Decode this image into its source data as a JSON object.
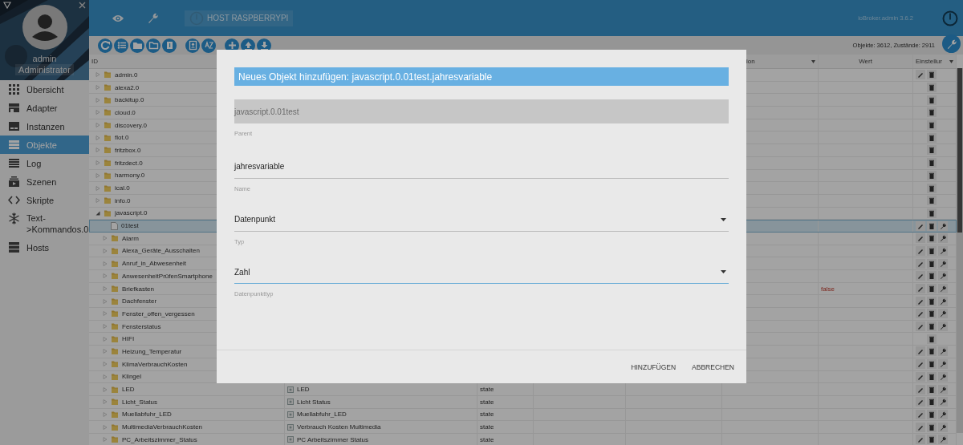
{
  "sidebar": {
    "user": {
      "name": "admin",
      "role": "Administrator"
    },
    "items": [
      {
        "label": "Übersicht",
        "selected": false
      },
      {
        "label": "Adapter",
        "selected": false
      },
      {
        "label": "Instanzen",
        "selected": false
      },
      {
        "label": "Objekte",
        "selected": true
      },
      {
        "label": "Log",
        "selected": false
      },
      {
        "label": "Szenen",
        "selected": false
      },
      {
        "label": "Skripte",
        "selected": false
      },
      {
        "label": "Text->Kommandos.0",
        "selected": false
      },
      {
        "label": "Hosts",
        "selected": false
      }
    ]
  },
  "header": {
    "host": "HOST RASPBERRYPI",
    "version": "ioBroker.admin 3.6.2"
  },
  "toolbar": {
    "stats": "Objekte: 3612, Zustände: 2911"
  },
  "table": {
    "columns": [
      {
        "label": "ID",
        "filter": false
      },
      {
        "label": "ion",
        "filter": true
      },
      {
        "label": "Wert",
        "filter": false
      },
      {
        "label": "Einstellur",
        "filter": true
      }
    ],
    "rows": [
      {
        "id": "admin.0",
        "kind": "folder",
        "expanded": false,
        "selected": false,
        "can_edit": true,
        "has_settings": false
      },
      {
        "id": "alexa2.0",
        "kind": "folder",
        "expanded": false,
        "selected": false,
        "can_edit": false,
        "has_settings": false
      },
      {
        "id": "backitup.0",
        "kind": "folder",
        "expanded": false,
        "selected": false,
        "can_edit": false,
        "has_settings": false
      },
      {
        "id": "cloud.0",
        "kind": "folder",
        "expanded": false,
        "selected": false,
        "can_edit": false,
        "has_settings": false
      },
      {
        "id": "discovery.0",
        "kind": "folder",
        "expanded": false,
        "selected": false,
        "can_edit": false,
        "has_settings": false
      },
      {
        "id": "flot.0",
        "kind": "folder",
        "expanded": false,
        "selected": false,
        "can_edit": false,
        "has_settings": false
      },
      {
        "id": "fritzbox.0",
        "kind": "folder",
        "expanded": false,
        "selected": false,
        "can_edit": false,
        "has_settings": false
      },
      {
        "id": "fritzdect.0",
        "kind": "folder",
        "expanded": false,
        "selected": false,
        "can_edit": false,
        "has_settings": false
      },
      {
        "id": "harmony.0",
        "kind": "folder",
        "expanded": false,
        "selected": false,
        "can_edit": false,
        "has_settings": false
      },
      {
        "id": "ical.0",
        "kind": "folder",
        "expanded": false,
        "selected": false,
        "can_edit": false,
        "has_settings": false
      },
      {
        "id": "info.0",
        "kind": "folder",
        "expanded": false,
        "selected": false,
        "can_edit": false,
        "has_settings": false
      },
      {
        "id": "javascript.0",
        "kind": "folder",
        "expanded": true,
        "selected": false,
        "can_edit": false,
        "has_settings": false,
        "children": [
          {
            "id": "01test",
            "kind": "file",
            "selected": true,
            "can_edit": true,
            "has_settings": true
          },
          {
            "id": "Alarm",
            "kind": "folder",
            "expanded": false,
            "selected": false,
            "can_edit": true,
            "has_settings": true
          },
          {
            "id": "Alexa_Geräte_Ausschalten",
            "kind": "folder",
            "expanded": false,
            "selected": false,
            "can_edit": true,
            "has_settings": true
          },
          {
            "id": "Anruf_in_Abwesenheit",
            "kind": "folder",
            "expanded": false,
            "selected": false,
            "can_edit": true,
            "has_settings": true
          },
          {
            "id": "AnwesenheitPrüfenSmartphone",
            "kind": "folder",
            "expanded": false,
            "selected": false,
            "can_edit": true,
            "has_settings": true
          },
          {
            "id": "Briefkasten",
            "kind": "folder",
            "expanded": false,
            "selected": false,
            "can_edit": true,
            "has_settings": true,
            "value": "false"
          },
          {
            "id": "Dachfenster",
            "kind": "folder",
            "expanded": false,
            "selected": false,
            "can_edit": true,
            "has_settings": true
          },
          {
            "id": "Fenster_offen_vergessen",
            "kind": "folder",
            "expanded": false,
            "selected": false,
            "can_edit": true,
            "has_settings": true
          },
          {
            "id": "Fensterstatus",
            "kind": "folder",
            "expanded": false,
            "selected": false,
            "can_edit": true,
            "has_settings": true
          },
          {
            "id": "HIFI",
            "kind": "folder",
            "expanded": false,
            "selected": false,
            "can_edit": false,
            "has_settings": false
          },
          {
            "id": "Heizung_Temperatur",
            "kind": "folder",
            "expanded": false,
            "selected": false,
            "can_edit": true,
            "has_settings": true
          },
          {
            "id": "KlimaVerbrauchKosten",
            "kind": "folder",
            "expanded": false,
            "selected": false,
            "can_edit": true,
            "has_settings": true
          },
          {
            "id": "Klingel",
            "kind": "folder",
            "expanded": false,
            "selected": false,
            "can_edit": true,
            "has_settings": true
          },
          {
            "id": "LED",
            "kind": "folder",
            "expanded": false,
            "selected": false,
            "can_edit": true,
            "has_settings": true,
            "name": "LED",
            "type": "state"
          },
          {
            "id": "Licht_Status",
            "kind": "folder",
            "expanded": false,
            "selected": false,
            "can_edit": true,
            "has_settings": true,
            "name": "Licht Status",
            "type": "state"
          },
          {
            "id": "Muellabfuhr_LED",
            "kind": "folder",
            "expanded": false,
            "selected": false,
            "can_edit": true,
            "has_settings": true,
            "name": "Muellabfuhr_LED",
            "type": "state"
          },
          {
            "id": "MultimediaVerbrauchKosten",
            "kind": "folder",
            "expanded": false,
            "selected": false,
            "can_edit": true,
            "has_settings": true,
            "name": "Verbrauch Kosten Multimedia",
            "type": "state"
          },
          {
            "id": "PC_Arbeitszimmer_Status",
            "kind": "folder",
            "expanded": false,
            "selected": false,
            "can_edit": true,
            "has_settings": true,
            "name": "PC Arbeitszimmer Status",
            "type": "state"
          }
        ]
      }
    ]
  },
  "dialog": {
    "title": "Neues Objekt hinzufügen: javascript.0.01test.jahresvariable",
    "fields": [
      {
        "kind": "readonly",
        "value": "javascript.0.01test",
        "label": "Parent",
        "focused": false
      },
      {
        "kind": "text",
        "value": "jahresvariable",
        "label": "Name",
        "focused": false
      },
      {
        "kind": "select",
        "value": "Datenpunkt",
        "label": "Typ",
        "focused": false
      },
      {
        "kind": "select",
        "value": "Zahl",
        "label": "Datenpunkttyp",
        "focused": true
      }
    ],
    "buttons": [
      "HINZUFÜGEN",
      "ABBRECHEN"
    ]
  }
}
